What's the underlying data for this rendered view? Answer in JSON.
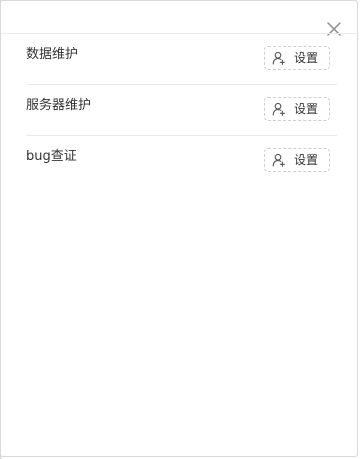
{
  "dialog": {
    "close_icon": "close-icon",
    "items": [
      {
        "label": "数据维护",
        "button_label": "设置",
        "button_icon": "user-settings-icon"
      },
      {
        "label": "服务器维护",
        "button_label": "设置",
        "button_icon": "user-settings-icon"
      },
      {
        "label": "bug查证",
        "button_label": "设置",
        "button_icon": "user-settings-icon"
      }
    ]
  },
  "colors": {
    "border": "#d9d9d9",
    "divider": "#e9e9e9",
    "text": "#333333",
    "icon": "#8c8c8c",
    "button_border": "#cfcfcf"
  }
}
